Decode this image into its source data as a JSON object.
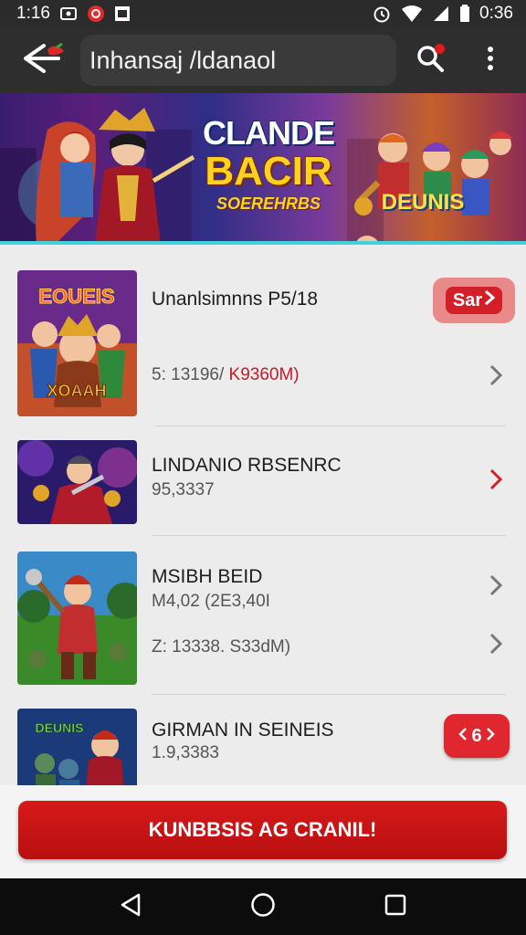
{
  "status_bar": {
    "time_left": "1:16",
    "time_right": "0:36"
  },
  "app_bar": {
    "title": "Inhansaj /ldanaol",
    "icons": [
      "back-arrow-icon",
      "search-icon",
      "more-vert-icon"
    ]
  },
  "banner": {
    "line1": "CLANDE",
    "line2": "BACIR",
    "line3": "SOEREHRBS",
    "side_title": "DEUNIS"
  },
  "list": {
    "items": [
      {
        "title": "Unanlsimnns P5/18",
        "subtitle_a": "5: 13196/ ",
        "subtitle_b": "K9360M)",
        "thumb_text": "EOUEIS",
        "thumb_text2": "XOAAH",
        "badge": "Sar"
      },
      {
        "title": "LINDANIO RBSENRC",
        "subtitle": "95,3337"
      },
      {
        "title": "MSIBH BEID",
        "subtitle": "M4,02 (2E3,40I",
        "subtitle2": "Z: 13338. S33dM)"
      },
      {
        "title": "GIRMAN IN SEINEIS",
        "subtitle": "1.9,3383",
        "thumb_text": "DEUNIS",
        "badge": "6"
      }
    ]
  },
  "cta": {
    "label": "KUNBBSIS AG CRANIL!"
  },
  "colors": {
    "accent_red": "#d61a1a",
    "app_bar_bg": "#2e2e2e",
    "status_bar_bg": "#2b2b2b",
    "nav_bar_bg": "#0c0c0c",
    "banner_teal_line": "#3fd3d8"
  }
}
